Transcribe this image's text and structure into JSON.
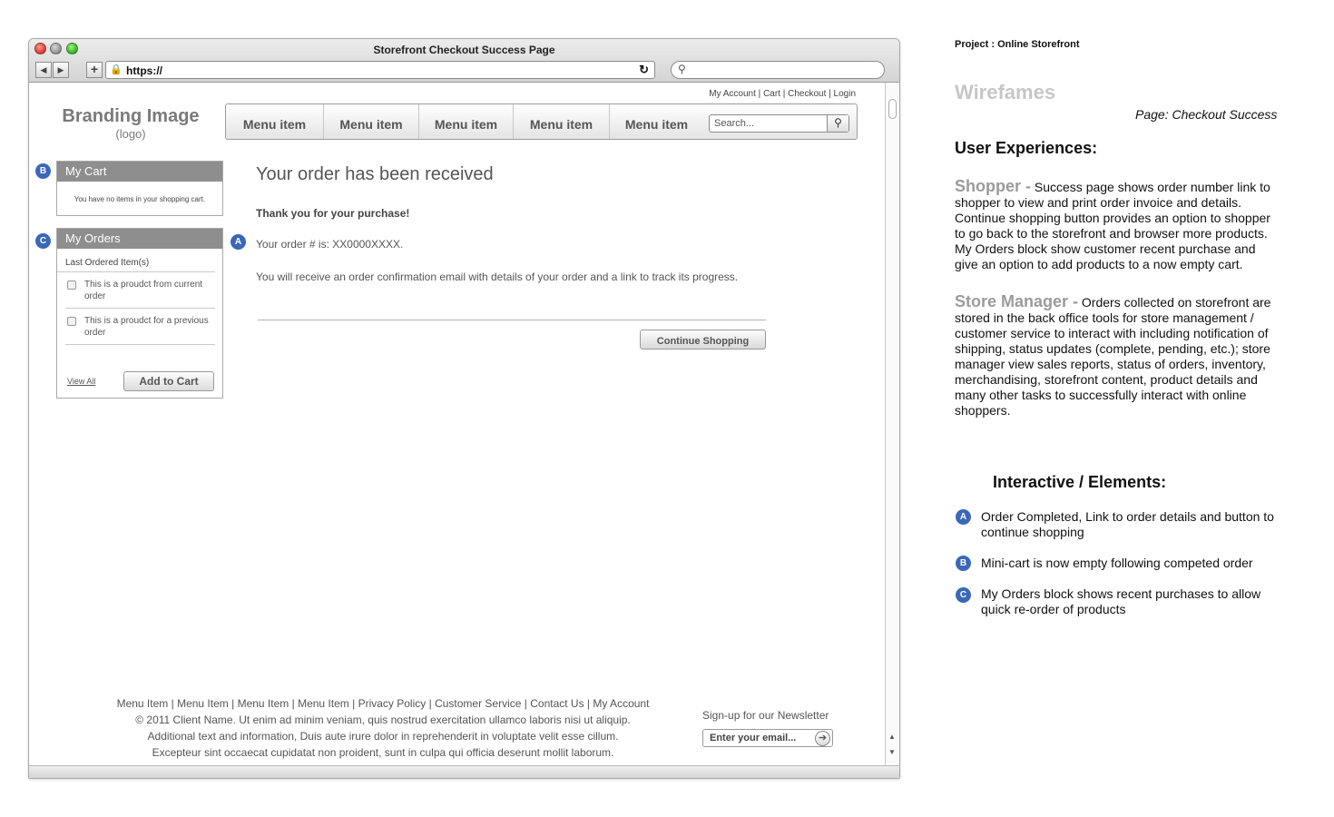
{
  "window": {
    "title": "Storefront Checkout Success Page",
    "url": "https://",
    "reload_icon": "reload-icon",
    "lock_icon": "lock-icon"
  },
  "util_nav": [
    "My Account",
    "Cart",
    "Checkout",
    "Login"
  ],
  "brand": {
    "title": "Branding Image",
    "subtitle": "(logo)"
  },
  "menu": {
    "items": [
      "Menu item",
      "Menu item",
      "Menu item",
      "Menu item",
      "Menu item"
    ],
    "search_placeholder": "Search..."
  },
  "cart": {
    "badge": "B",
    "title": "My Cart",
    "empty_text": "You have no items in your shopping cart."
  },
  "orders": {
    "badge": "C",
    "title": "My Orders",
    "last_label": "Last Ordered Item(s)",
    "products": [
      "This is a proudct from current order",
      "This is a proudct for a previous order"
    ],
    "view_all": "View All",
    "add_to_cart": "Add to Cart"
  },
  "main": {
    "badge": "A",
    "heading": "Your order has been received",
    "thanks": "Thank you for your purchase!",
    "order_number": "Your order # is: XX0000XXXX.",
    "confirmation": "You will receive an order confirmation email with details of your order and a link to track its progress.",
    "continue_button": "Continue Shopping"
  },
  "footer": {
    "links": [
      "Menu Item",
      "Menu Item",
      "Menu Item",
      "Menu Item",
      "Privacy Policy",
      "Customer Service",
      "Contact Us",
      "My Account"
    ],
    "copyright": "© 2011 Client Name. Ut enim ad minim veniam, quis nostrud exercitation ullamco laboris nisi ut aliquip.",
    "line2": "Additional text and information, Duis aute irure dolor in reprehenderit in voluptate velit esse cillum.",
    "line3": "Excepteur sint occaecat cupidatat non proident, sunt in culpa qui officia deserunt mollit laborum.",
    "newsletter_label": "Sign-up for our Newsletter",
    "newsletter_placeholder": "Enter your email..."
  },
  "panel": {
    "project": "Project : Online Storefront",
    "wireframes": "Wirefames",
    "page_label": "Page: Checkout Success",
    "ux_title": "User Experiences:",
    "shopper_lead": "Shopper -",
    "shopper_text": " Success page shows order number link to shopper to view and print order invoice and details. Continue shopping button provides an option to shopper to go back to the storefront and browser more products. My Orders block show customer recent purchase and give an option to add products to a now empty cart.",
    "manager_lead": "Store Manager -",
    "manager_text": " Orders collected on storefront are stored in the back office tools for store management / customer service to interact with including notification of shipping, status updates (complete, pending, etc.); store manager view sales reports, status of orders, inventory, merchandising, storefront content, product details and many other tasks to successfully interact with online shoppers.",
    "ie_title": "Interactive / Elements:",
    "annotations": [
      {
        "badge": "A",
        "text": "Order Completed, Link to order details and button to continue shopping"
      },
      {
        "badge": "B",
        "text": "Mini-cart is now empty following competed order"
      },
      {
        "badge": "C",
        "text": "My Orders block shows recent purchases to allow quick re-order of products"
      }
    ]
  },
  "colors": {
    "badge": "#3a67b8",
    "box_header": "#8e8e8e",
    "lead_gray": "#9b9b9b"
  }
}
